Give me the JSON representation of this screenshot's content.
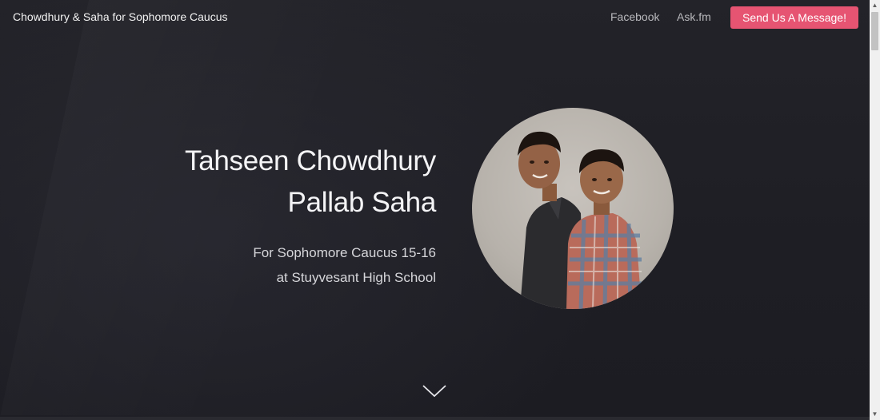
{
  "navbar": {
    "brand": "Chowdhury & Saha for Sophomore Caucus",
    "links": [
      "Facebook",
      "Ask.fm"
    ],
    "cta_label": "Send Us A Message!"
  },
  "hero": {
    "names": [
      "Tahseen Chowdhury",
      "Pallab Saha"
    ],
    "subtitle_lines": [
      "For Sophomore Caucus 15-16",
      "at Stuyvesant High School"
    ]
  },
  "icons": {
    "scroll": "chevron-down-icon",
    "scrollbar_up": "triangle-up-icon",
    "scrollbar_down": "triangle-down-icon"
  },
  "colors": {
    "background": "#1f1f25",
    "accent": "#e65472",
    "text": "#f4f4f6"
  }
}
